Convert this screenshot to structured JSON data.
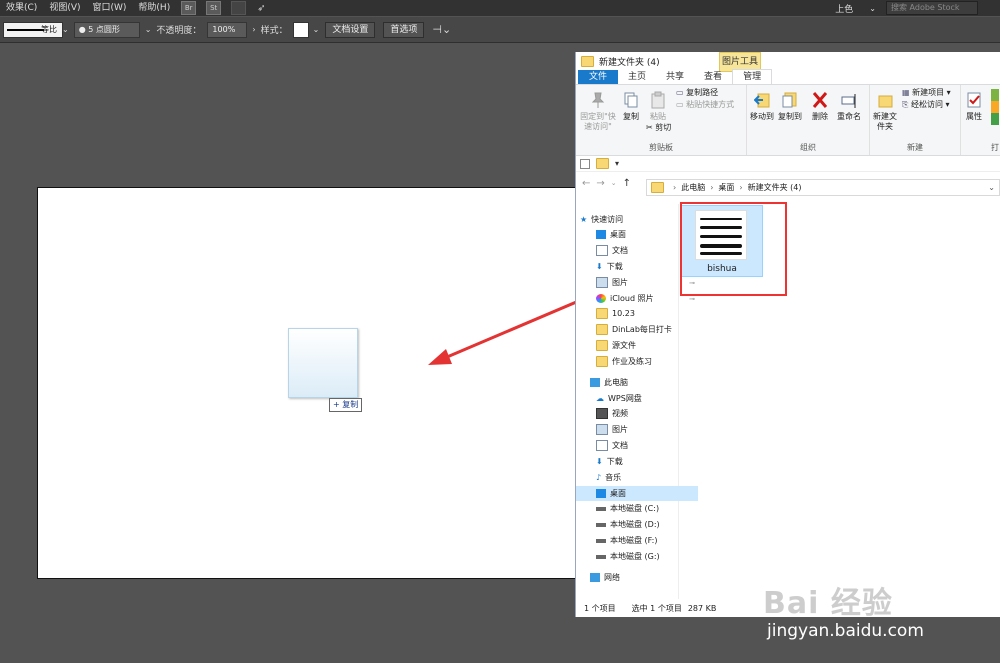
{
  "illustrator": {
    "menu": [
      "效果(C)",
      "视图(V)",
      "窗口(W)",
      "帮助(H)"
    ],
    "bridge_icons": [
      "Br",
      "St"
    ],
    "workspace": "上色",
    "search_placeholder": "搜索 Adobe Stock",
    "control": {
      "stroke_profile": "等比",
      "brush": "5 点圆形",
      "opacity_label": "不透明度：",
      "opacity_value": "100%",
      "style_label": "样式：",
      "doc_setup": "文档设置",
      "preferences": "首选项"
    },
    "drag_copy_label": "+ 复制"
  },
  "explorer": {
    "title": "新建文件夹 (4)",
    "context_tool": "图片工具",
    "tabs": [
      "文件",
      "主页",
      "共享",
      "查看",
      "管理"
    ],
    "ribbon": {
      "clipboard": {
        "pin": "固定到\"快速访问\"",
        "copy": "复制",
        "paste": "粘贴",
        "copy_path": "复制路径",
        "paste_shortcut": "粘贴快捷方式",
        "cut": "剪切",
        "label": "剪贴板"
      },
      "organize": {
        "move_to": "移动到",
        "copy_to": "复制到",
        "delete": "删除",
        "rename": "重命名",
        "label": "组织"
      },
      "new": {
        "new_folder": "新建文件夹",
        "new_item": "新建项目",
        "easy_access": "经松访问",
        "label": "新建"
      },
      "open": {
        "properties": "属性",
        "label": "打"
      }
    },
    "breadcrumb": [
      "此电脑",
      "桌面",
      "新建文件夹 (4)"
    ],
    "nav": {
      "quick_access": "快速访问",
      "quick_items": [
        "桌面",
        "文档",
        "下载",
        "图片",
        "iCloud 照片",
        "10.23",
        "DinLab每日打卡",
        "源文件",
        "作业及练习"
      ],
      "this_pc": "此电脑",
      "pc_items": [
        "WPS网盘",
        "视频",
        "图片",
        "文档",
        "下载",
        "音乐",
        "桌面",
        "本地磁盘 (C:)",
        "本地磁盘 (D:)",
        "本地磁盘 (F:)",
        "本地磁盘 (G:)"
      ],
      "network": "网络"
    },
    "file": {
      "name": "bishua"
    },
    "status": {
      "count": "1 个项目",
      "selected": "选中 1 个项目",
      "size": "287 KB"
    }
  },
  "watermark": {
    "logo": "Bai 经验",
    "url": "jingyan.baidu.com"
  },
  "colors": {
    "annotation_red": "#e33333",
    "explorer_blue": "#1979ca",
    "selection": "#cce8ff"
  }
}
